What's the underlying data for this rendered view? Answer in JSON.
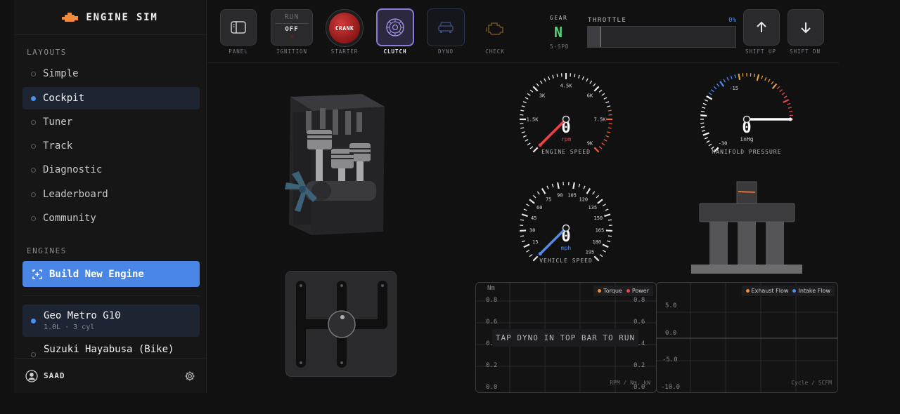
{
  "brand": {
    "title": "ENGINE SIM"
  },
  "sidebar": {
    "layouts_label": "LAYOUTS",
    "layouts": [
      {
        "label": "Simple",
        "active": false
      },
      {
        "label": "Cockpit",
        "active": true
      },
      {
        "label": "Tuner",
        "active": false
      },
      {
        "label": "Track",
        "active": false
      },
      {
        "label": "Diagnostic",
        "active": false
      },
      {
        "label": "Leaderboard",
        "active": false
      },
      {
        "label": "Community",
        "active": false
      }
    ],
    "engines_label": "ENGINES",
    "build_label": "Build New Engine",
    "engines": [
      {
        "name": "Geo Metro G10",
        "detail": "1.0L · 3 cyl",
        "active": true
      },
      {
        "name": "Suzuki Hayabusa (Bike)",
        "detail": "",
        "active": false
      }
    ],
    "user": "SAAD"
  },
  "topbar": {
    "panel_label": "PANEL",
    "ignition": {
      "run": "RUN",
      "off": "OFF",
      "label": "IGNITION"
    },
    "starter": {
      "button": "CRANK",
      "label": "STARTER"
    },
    "clutch_label": "CLUTCH",
    "dyno_label": "DYNO",
    "check_label": "CHECK",
    "gear": {
      "label": "GEAR",
      "value": "N",
      "sub": "5-SPD"
    },
    "throttle": {
      "label": "THROTTLE",
      "percent": "0%",
      "value": 0
    },
    "shift_up_label": "SHIFT UP",
    "shift_down_label": "SHIFT DN"
  },
  "gauges": {
    "engine_speed": {
      "title": "ENGINE SPEED",
      "unit": "rpm",
      "value": "0",
      "ticks": [
        "1.5K",
        "3K",
        "4.5K",
        "6K",
        "7.5K",
        "9K"
      ]
    },
    "manifold": {
      "title": "MANIFOLD PRESSURE",
      "unit": "inHg",
      "value": "0",
      "ticks": [
        "-30",
        "-15"
      ]
    },
    "vehicle_speed": {
      "title": "VEHICLE SPEED",
      "unit": "mph",
      "value": "0",
      "ticks": [
        "15",
        "30",
        "45",
        "60",
        "75",
        "90",
        "105",
        "120",
        "135",
        "150",
        "165",
        "180",
        "195"
      ]
    }
  },
  "dyno_graph": {
    "y_label": "Nm",
    "left_ticks": [
      "0.8",
      "0.6",
      "0.4",
      "0.2",
      "0.0"
    ],
    "right_ticks": [
      "0.8",
      "0.6",
      "0.4",
      "0.2",
      "0.0"
    ],
    "legend": [
      {
        "name": "Torque",
        "color": "#f08a3c"
      },
      {
        "name": "Power",
        "color": "#e8454a"
      }
    ],
    "axis_note": "RPM / Nm, kW",
    "overlay": "TAP DYNO IN TOP BAR TO RUN"
  },
  "flow_graph": {
    "ticks": [
      "5.0",
      "0.0",
      "-5.0",
      "-10.0"
    ],
    "legend": [
      {
        "name": "Exhaust Flow",
        "color": "#f08a3c"
      },
      {
        "name": "Intake Flow",
        "color": "#4b8ef0"
      }
    ],
    "axis_note": "Cycle / SCFM"
  },
  "colors": {
    "accent": "#4a86e6",
    "gear": "#56d275",
    "redline": "#e8454a",
    "speed_needle": "#4b8ef0"
  }
}
